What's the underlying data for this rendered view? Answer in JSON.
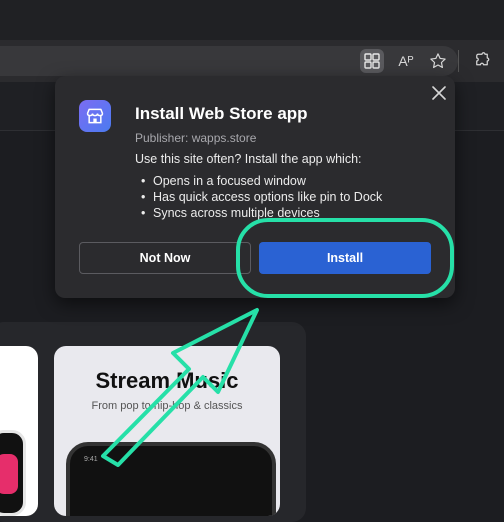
{
  "toolbar": {
    "icons": [
      "apps-icon",
      "read-aloud-icon",
      "favorite-star-icon",
      "extensions-icon"
    ],
    "read_aloud_glyph": "Aᴾ"
  },
  "background_page": {
    "stream_card": {
      "title": "Stream Music",
      "subtitle": "From pop to hip-hop & classics",
      "phone_time": "9:41"
    }
  },
  "install_dialog": {
    "title": "Install Web Store app",
    "publisher": "Publisher: wapps.store",
    "question": "Use this site often? Install the app which:",
    "features": [
      "Opens in a focused window",
      "Has quick access options like pin to Dock",
      "Syncs across multiple devices"
    ],
    "not_now_label": "Not Now",
    "install_label": "Install",
    "install_color": "#2a62d3"
  },
  "annotation": {
    "highlight_color": "#26e0a8",
    "highlight_target": "install-button"
  }
}
